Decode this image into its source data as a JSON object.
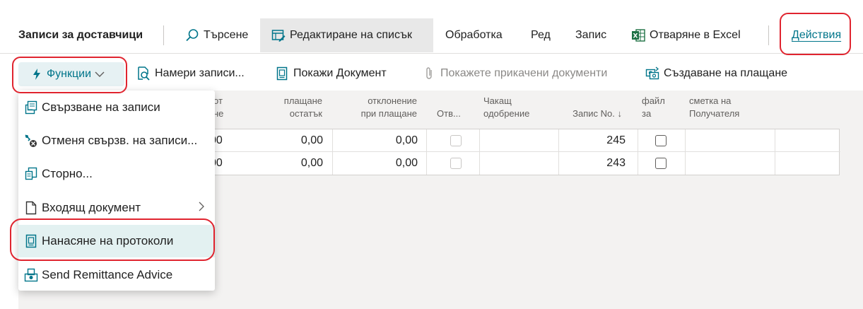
{
  "page_title": "Записи за доставчици",
  "topbar": {
    "search": "Търсене",
    "edit_list": "Редактиране на списък",
    "processing": "Обработка",
    "line": "Ред",
    "entry": "Запис",
    "open_excel": "Отваряне в Excel",
    "actions": "Действия"
  },
  "bar2": {
    "functions": "Функции",
    "find_entries": "Намери записи...",
    "show_document": "Покажи Документ",
    "show_attachments": "Покажете прикачени документи",
    "create_payment": "Създаване на плащане"
  },
  "table": {
    "headers": {
      "col_a_l1": "от",
      "col_a_l2": "не",
      "remaining_l1": "плащане",
      "remaining_l2": "остатък",
      "tolerance_l1": "отклонение",
      "tolerance_l2": "при плащане",
      "open": "Отв...",
      "pending_l1": "Чакащ",
      "pending_l2": "одобрение",
      "entry_no": "Запис No.",
      "file_l1": "файл",
      "file_l2": "за",
      "recipient_l1": "сметка на",
      "recipient_l2": "Получателя"
    },
    "rows": [
      {
        "col_a": "00",
        "remaining": "0,00",
        "tolerance": "0,00",
        "entry_no": "245"
      },
      {
        "col_a": "00",
        "remaining": "0,00",
        "tolerance": "0,00",
        "entry_no": "243"
      }
    ]
  },
  "menu": {
    "items": [
      {
        "label": "Свързване на записи",
        "icon": "apply-entries-icon"
      },
      {
        "label": "Отменя свързв. на записи...",
        "icon": "unapply-entries-icon"
      },
      {
        "label": "Сторно...",
        "icon": "reverse-icon"
      },
      {
        "label": "Входящ документ",
        "icon": "document-icon",
        "submenu": true
      },
      {
        "label": "Нанасяне на протоколи",
        "icon": "post-icon",
        "highlighted": true
      },
      {
        "label": "Send Remittance Advice",
        "icon": "remittance-icon"
      }
    ]
  },
  "colors": {
    "accent": "#00758a",
    "annotation": "#e0242f",
    "excel_green": "#1e7145"
  }
}
